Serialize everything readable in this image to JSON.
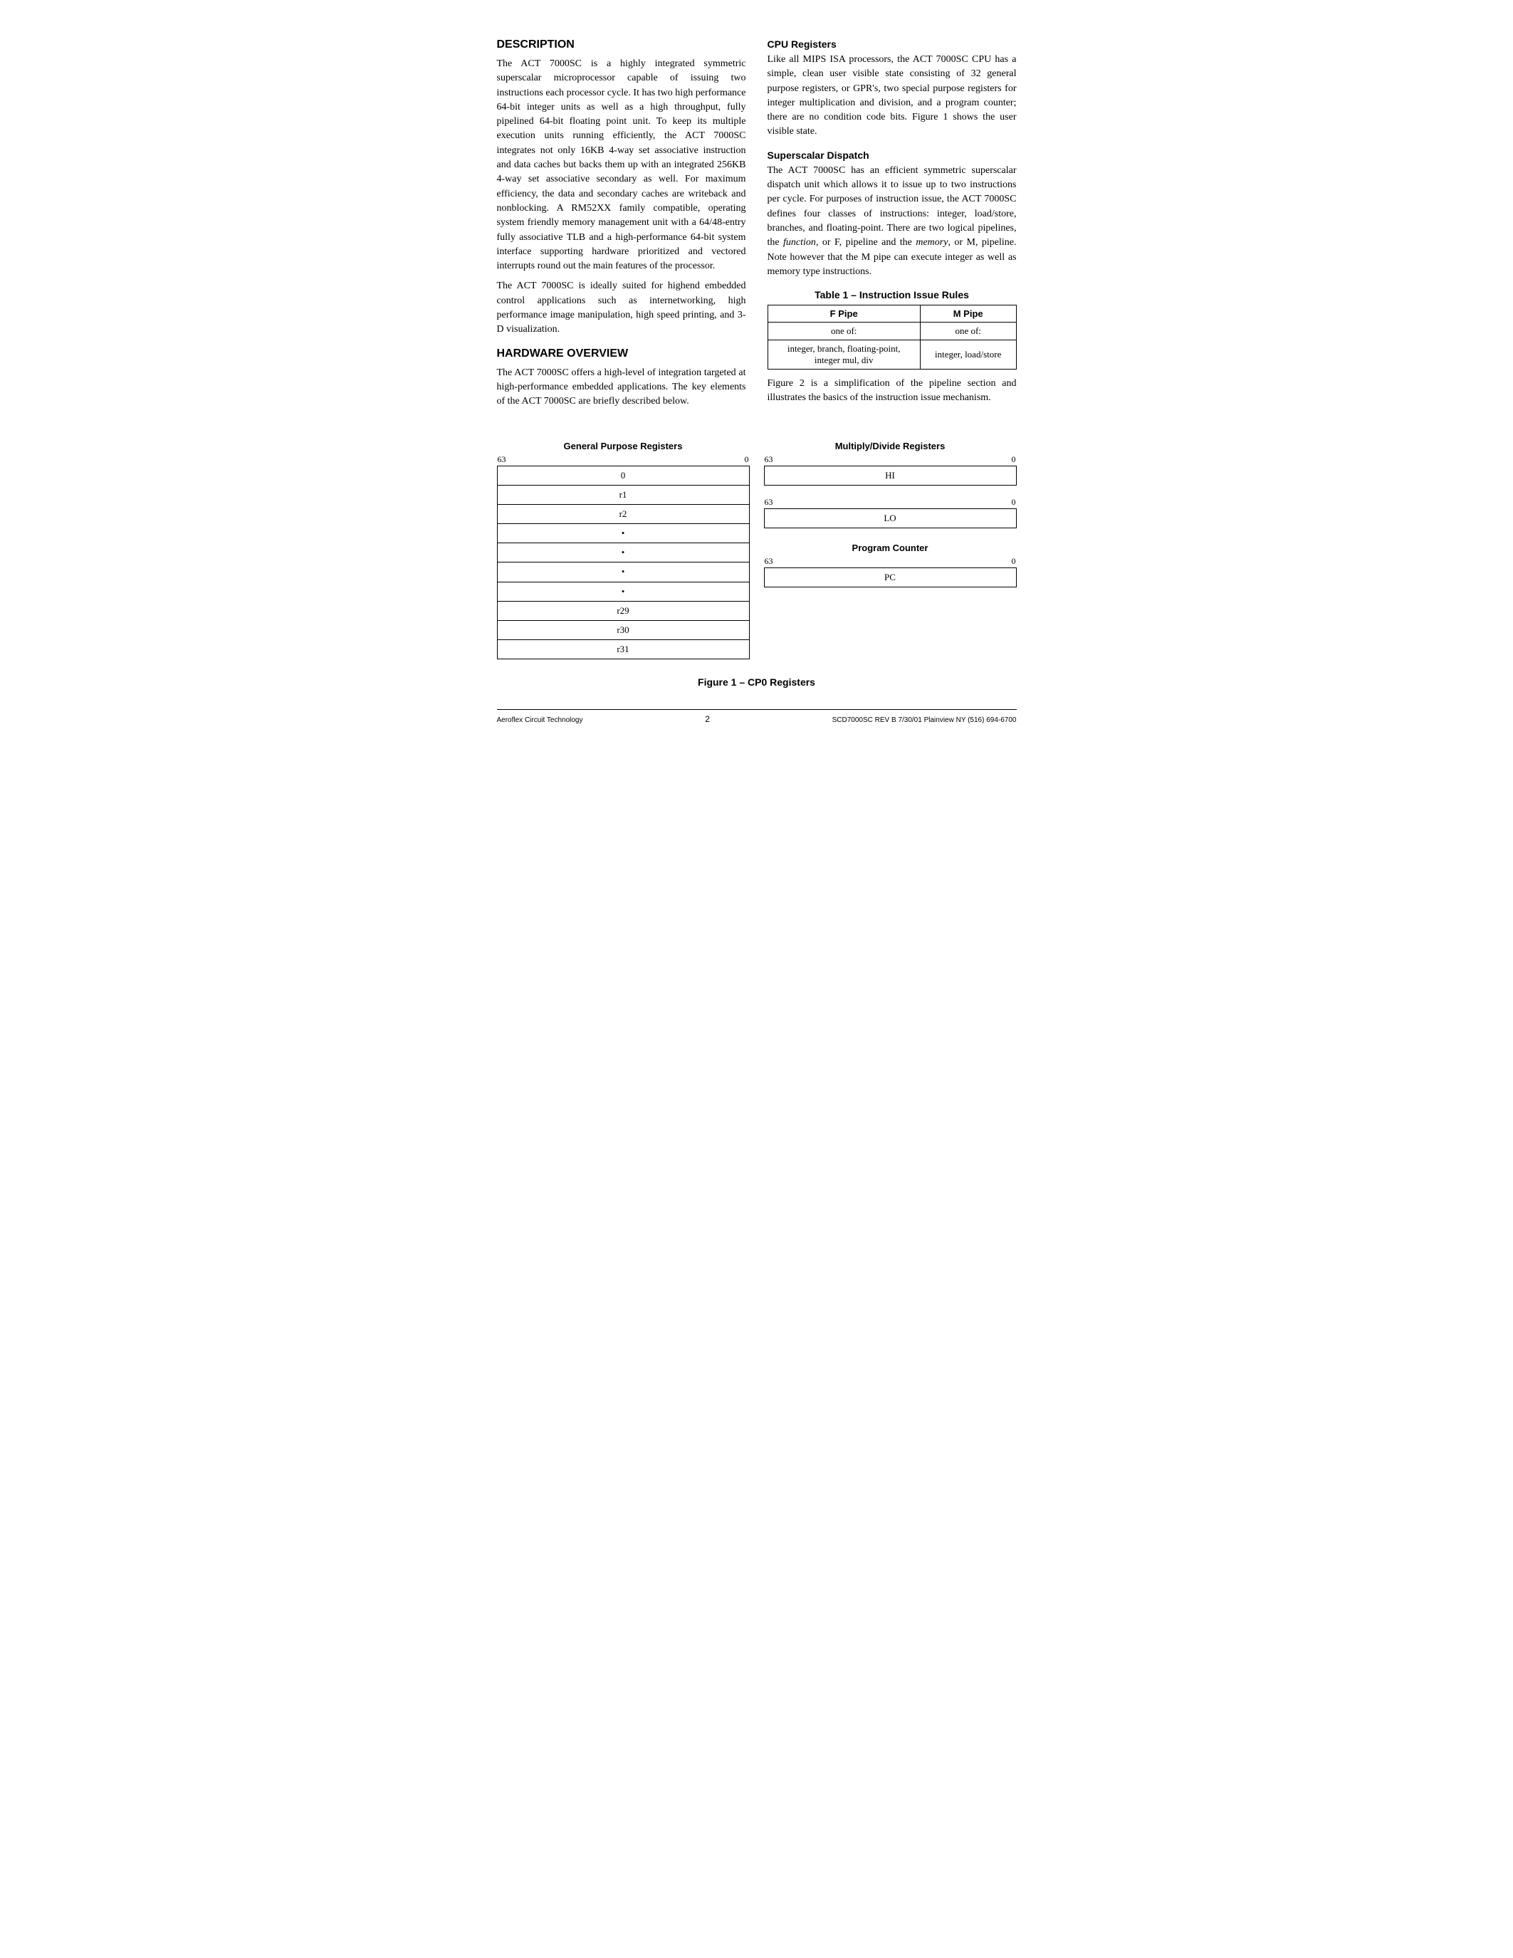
{
  "page": {
    "sections": {
      "description": {
        "title": "DESCRIPTION",
        "paragraphs": [
          "The ACT 7000SC is a highly integrated symmetric superscalar microprocessor capable of issuing two instructions each processor cycle. It has two high performance 64-bit integer units as well as a high throughput, fully pipelined 64-bit floating point unit. To keep its multiple execution units running efficiently, the ACT 7000SC integrates not only 16KB 4-way set associative instruction and data caches but backs them up with an integrated 256KB 4-way set associative secondary as well. For maximum efficiency, the data and secondary caches are writeback and nonblocking. A RM52XX family compatible, operating system friendly memory management unit with a 64/48-entry fully associative TLB and a high-performance 64-bit system interface supporting hardware prioritized and vectored interrupts round out the main features of the processor.",
          "The ACT 7000SC is ideally suited for highend embedded control applications such as internetworking, high performance image manipulation, high speed printing, and 3-D visualization."
        ]
      },
      "hardware_overview": {
        "title": "HARDWARE OVERVIEW",
        "paragraphs": [
          "The ACT 7000SC offers a high-level of integration targeted at high-performance embedded applications. The key elements of the ACT 7000SC are briefly described below."
        ]
      },
      "cpu_registers": {
        "title": "CPU Registers",
        "paragraphs": [
          "Like all MIPS ISA processors, the ACT 7000SC CPU has a simple, clean user visible state consisting of 32 general purpose registers, or GPR's, two special purpose registers for integer multiplication and division, and a program counter; there are no condition code bits. Figure 1 shows the user visible state."
        ]
      },
      "superscalar_dispatch": {
        "title": "Superscalar Dispatch",
        "paragraphs": [
          "The ACT 7000SC has an efficient symmetric superscalar dispatch unit which allows it to issue up to two instructions per cycle. For purposes of instruction issue, the ACT 7000SC defines four classes of instructions: integer, load/store, branches, and floating-point. There are two logical pipelines, the function, or F, pipeline and the memory, or M, pipeline. Note however that the M pipe can execute integer as well as memory type instructions."
        ]
      },
      "table": {
        "title": "Table 1 – Instruction Issue Rules",
        "headers": [
          "F Pipe",
          "M Pipe"
        ],
        "rows": [
          [
            "one of:",
            "one of:"
          ],
          [
            "integer, branch, floating-point,\ninteger mul, div",
            "integer, load/store"
          ]
        ]
      },
      "figure_note": "Figure 2 is a simplification of the pipeline section and illustrates the basics of the instruction issue mechanism."
    },
    "figure": {
      "gpr": {
        "title": "General Purpose Registers",
        "bit_high": "63",
        "bit_low": "0",
        "rows": [
          "0",
          "r1",
          "r2",
          "•",
          "•",
          "•",
          "•",
          "r29",
          "r30",
          "r31"
        ]
      },
      "mdr": {
        "title": "Multiply/Divide Registers",
        "groups": [
          {
            "bit_high": "63",
            "bit_low": "0",
            "rows": [
              "HI"
            ]
          },
          {
            "bit_high": "63",
            "bit_low": "0",
            "rows": [
              "LO"
            ]
          }
        ]
      },
      "pc": {
        "title": "Program Counter",
        "bit_high": "63",
        "bit_low": "0",
        "rows": [
          "PC"
        ]
      },
      "caption": "Figure 1 – CP0 Registers"
    },
    "footer": {
      "left": "Aeroflex Circuit Technology",
      "center": "2",
      "right": "SCD7000SC REV B  7/30/01  Plainview NY (516) 694-6700"
    }
  }
}
